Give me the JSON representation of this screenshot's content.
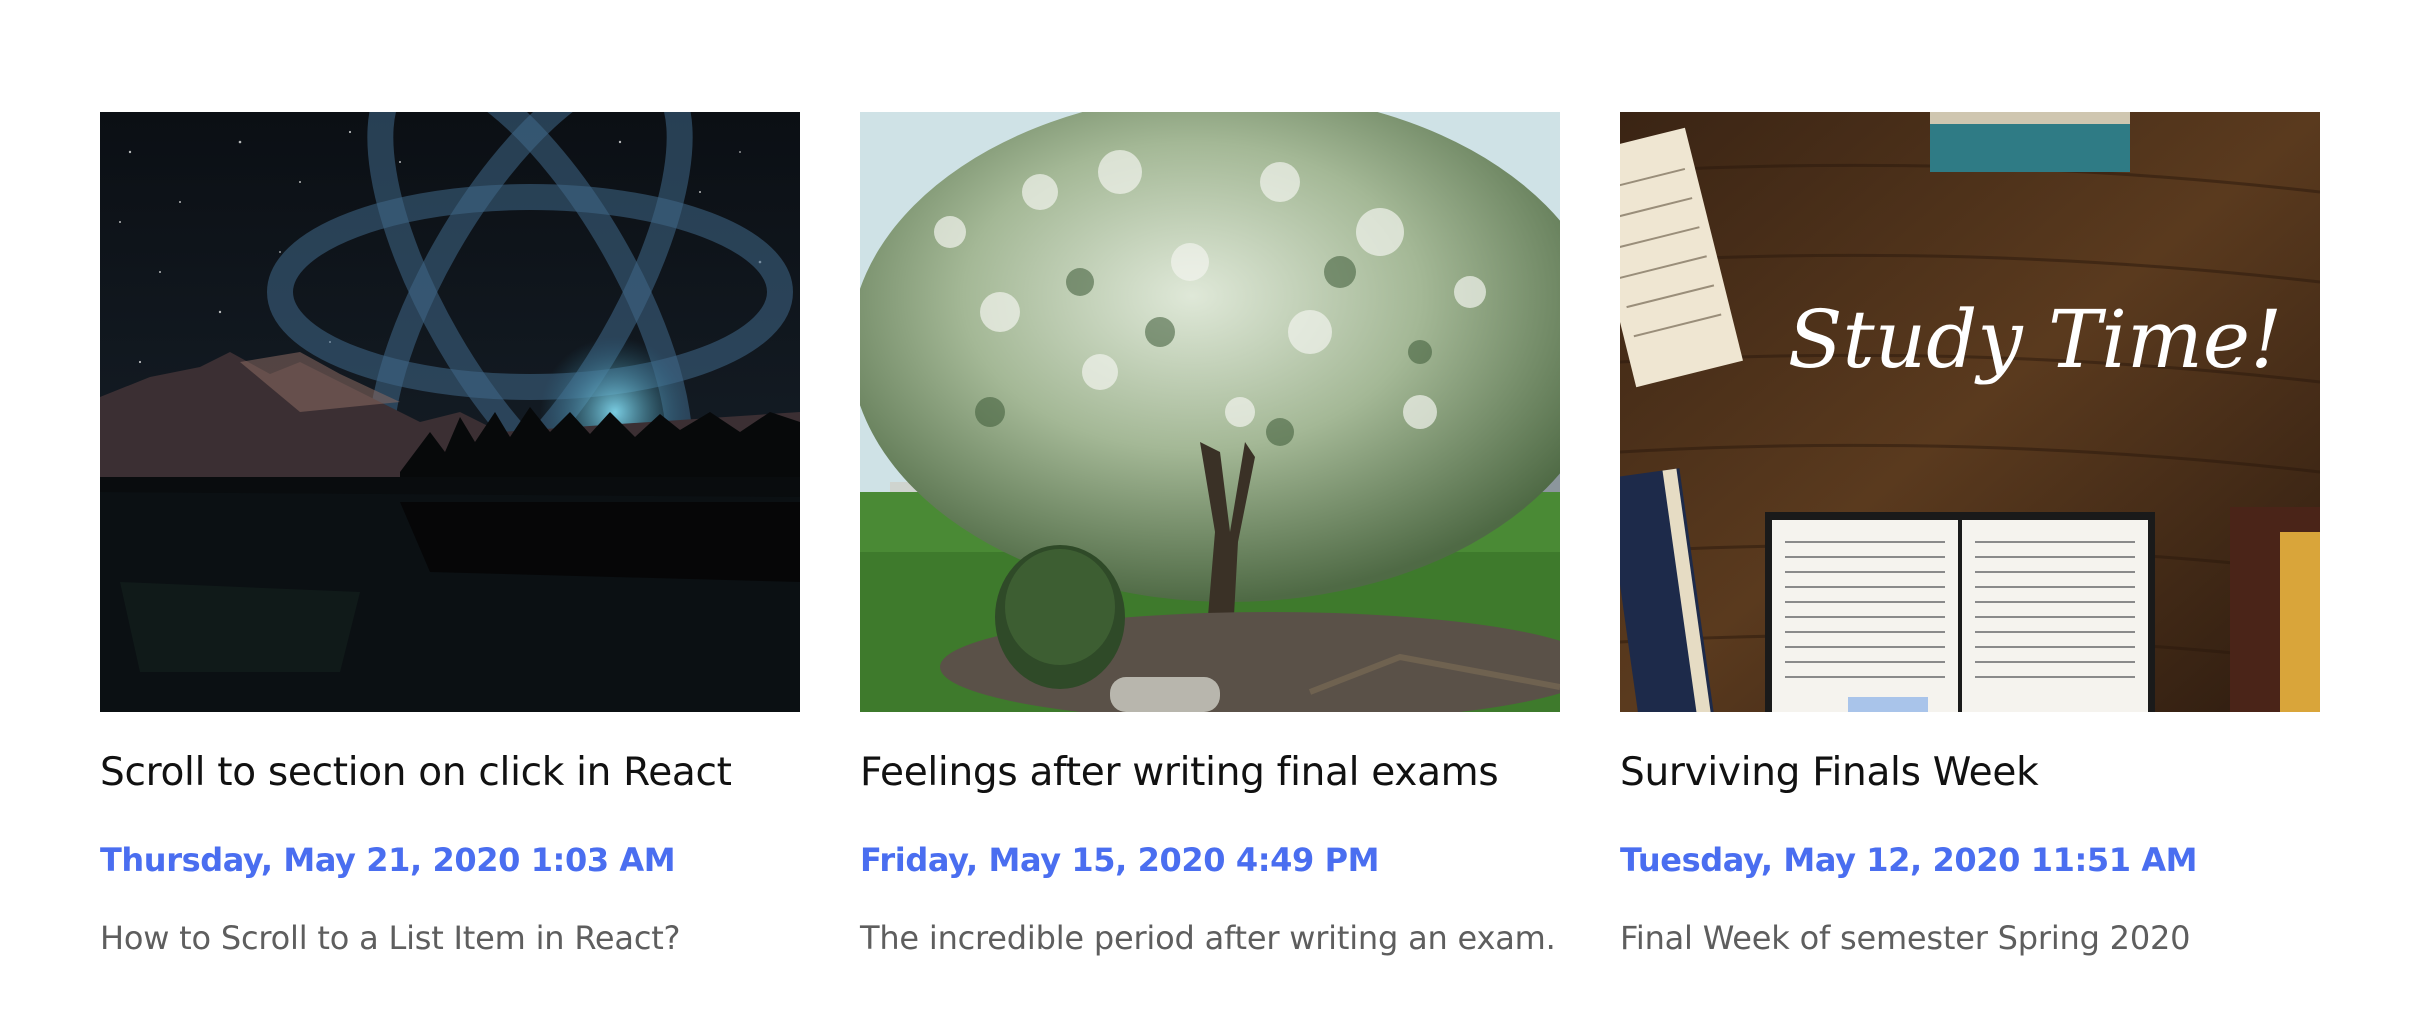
{
  "posts": [
    {
      "title": "Scroll to section on click in React",
      "date": "Thursday, May 21, 2020 1:03 AM",
      "excerpt": "How to Scroll to a List Item in React?",
      "image": "night-sky-lake-react-logo"
    },
    {
      "title": "Feelings after writing final exams",
      "date": "Friday, May 15, 2020 4:49 PM",
      "excerpt": "The incredible period after writing an exam.",
      "image": "blossoming-tree-yard"
    },
    {
      "title": "Surviving Finals Week",
      "date": "Tuesday, May 12, 2020 11:51 AM",
      "excerpt": "Final Week of semester Spring 2020",
      "image": "study-desk-open-book",
      "image_text": "Study Time!"
    }
  ],
  "colors": {
    "date": "#4a6ef0",
    "title": "#111111",
    "excerpt": "#5e5e5e"
  }
}
